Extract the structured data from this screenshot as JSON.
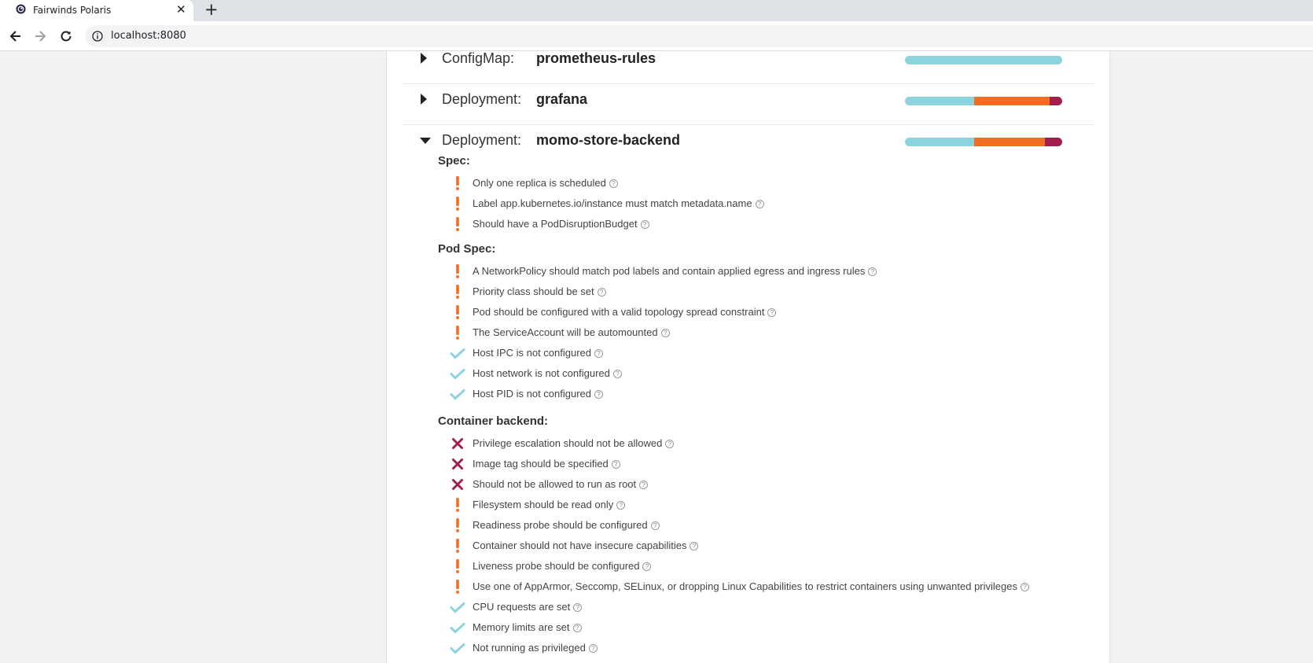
{
  "browser": {
    "tab_title": "Fairwinds Polaris",
    "tab_close": "✕",
    "new_tab": "+",
    "url": "localhost:8080"
  },
  "resources": [
    {
      "kind": "ConfigMap:",
      "name": "prometheus-rules",
      "expanded": false,
      "score": {
        "passing": 1.0,
        "warning": 0.0,
        "danger": 0.0
      }
    },
    {
      "kind": "Deployment:",
      "name": "grafana",
      "expanded": false,
      "score": {
        "passing": 0.44,
        "warning": 0.48,
        "danger": 0.08
      }
    },
    {
      "kind": "Deployment:",
      "name": "momo-store-backend",
      "expanded": true,
      "score": {
        "passing": 0.44,
        "warning": 0.45,
        "danger": 0.11
      }
    }
  ],
  "colors": {
    "passing": "#8dd3df",
    "warning": "#f26c21",
    "danger": "#a11f4c"
  },
  "sections": [
    {
      "title": "Spec:",
      "checks": [
        {
          "status": "warning",
          "text": "Only one replica is scheduled"
        },
        {
          "status": "warning",
          "text": "Label app.kubernetes.io/instance must match metadata.name"
        },
        {
          "status": "warning",
          "text": "Should have a PodDisruptionBudget"
        }
      ]
    },
    {
      "title": "Pod Spec:",
      "checks": [
        {
          "status": "warning",
          "text": "A NetworkPolicy should match pod labels and contain applied egress and ingress rules"
        },
        {
          "status": "warning",
          "text": "Priority class should be set"
        },
        {
          "status": "warning",
          "text": "Pod should be configured with a valid topology spread constraint"
        },
        {
          "status": "warning",
          "text": "The ServiceAccount will be automounted"
        },
        {
          "status": "passing",
          "text": "Host IPC is not configured"
        },
        {
          "status": "passing",
          "text": "Host network is not configured"
        },
        {
          "status": "passing",
          "text": "Host PID is not configured"
        }
      ]
    },
    {
      "title": "Container backend:",
      "checks": [
        {
          "status": "danger",
          "text": "Privilege escalation should not be allowed"
        },
        {
          "status": "danger",
          "text": "Image tag should be specified"
        },
        {
          "status": "danger",
          "text": "Should not be allowed to run as root"
        },
        {
          "status": "warning",
          "text": "Filesystem should be read only"
        },
        {
          "status": "warning",
          "text": "Readiness probe should be configured"
        },
        {
          "status": "warning",
          "text": "Container should not have insecure capabilities"
        },
        {
          "status": "warning",
          "text": "Liveness probe should be configured"
        },
        {
          "status": "warning",
          "text": "Use one of AppArmor, Seccomp, SELinux, or dropping Linux Capabilities to restrict containers using unwanted privileges"
        },
        {
          "status": "passing",
          "text": "CPU requests are set"
        },
        {
          "status": "passing",
          "text": "Memory limits are set"
        },
        {
          "status": "passing",
          "text": "Not running as privileged"
        }
      ]
    }
  ],
  "help_glyph": "?"
}
